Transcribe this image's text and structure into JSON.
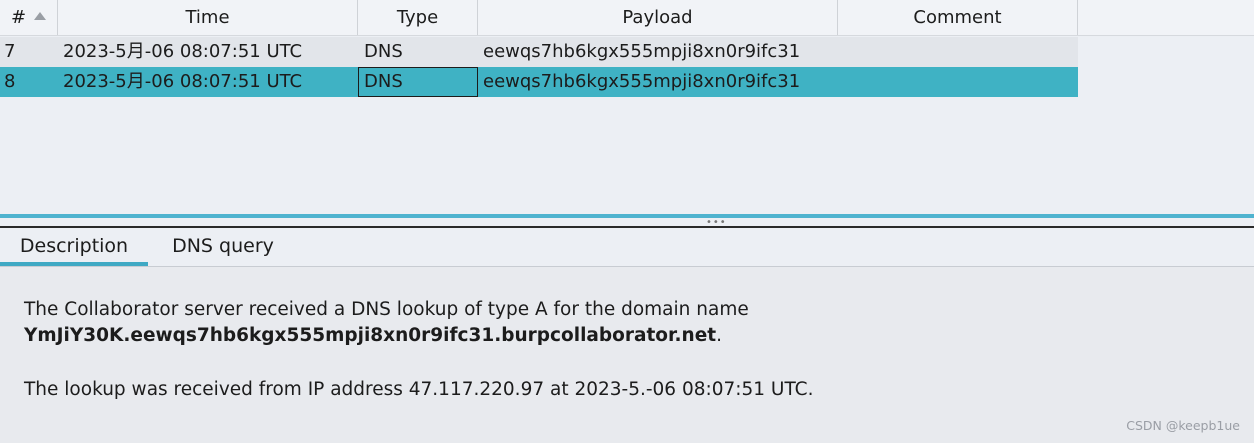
{
  "table": {
    "columns": [
      "#",
      "Time",
      "Type",
      "Payload",
      "Comment"
    ],
    "rows": [
      {
        "num": "7",
        "time": "2023-5月-06 08:07:51 UTC",
        "type": "DNS",
        "payload": "eewqs7hb6kgx555mpji8xn0r9ifc31",
        "comment": ""
      },
      {
        "num": "8",
        "time": "2023-5月-06 08:07:51 UTC",
        "type": "DNS",
        "payload": "eewqs7hb6kgx555mpji8xn0r9ifc31",
        "comment": ""
      }
    ],
    "selected_row": 1,
    "sort_icon": "sort-ascending-icon"
  },
  "tabs": [
    "Description",
    "DNS query"
  ],
  "active_tab": 0,
  "description": {
    "line1": "The Collaborator server received a DNS lookup of type A for the domain name",
    "domain_bold": "YmJiY30K.eewqs7hb6kgx555mpji8xn0r9ifc31.burpcollaborator.net",
    "domain_suffix": ".",
    "line3": "The lookup was received from IP address 47.117.220.97 at 2023-5.-06 08:07:51 UTC."
  },
  "watermark": "CSDN @keepb1ue",
  "colors": {
    "selection": "#3fb2c4",
    "tab_underline": "#3fa9c4",
    "divider_blue": "#4fb3cf"
  }
}
